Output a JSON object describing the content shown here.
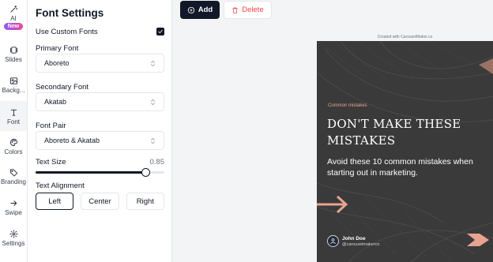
{
  "rail": {
    "items": [
      {
        "label": "AI",
        "badge": "New",
        "icon": "magic-wand-icon"
      },
      {
        "label": "Slides",
        "icon": "slides-icon"
      },
      {
        "label": "Backg...",
        "icon": "image-icon"
      },
      {
        "label": "Font",
        "icon": "font-icon"
      },
      {
        "label": "Colors",
        "icon": "palette-icon"
      },
      {
        "label": "Branding",
        "icon": "tag-icon"
      },
      {
        "label": "Swipe",
        "icon": "arrow-right-icon"
      },
      {
        "label": "Settings",
        "icon": "gear-icon"
      }
    ],
    "active": "Font"
  },
  "panel": {
    "title": "Font Settings",
    "use_custom_fonts": {
      "label": "Use Custom Fonts",
      "checked": true
    },
    "primary_font": {
      "label": "Primary Font",
      "value": "Aboreto"
    },
    "secondary_font": {
      "label": "Secondary Font",
      "value": "Akatab"
    },
    "font_pair": {
      "label": "Font Pair",
      "value": "Aboreto & Akatab"
    },
    "text_size": {
      "label": "Text Size",
      "value": "0.85",
      "level": 0.85
    },
    "text_alignment": {
      "label": "Text Alignment",
      "options": [
        "Left",
        "Center",
        "Right"
      ],
      "selected": "Left"
    }
  },
  "toolbar": {
    "add_label": "Add",
    "delete_label": "Delete"
  },
  "slide": {
    "created_with": "Created with CarouselMaker.co",
    "eyebrow": "Common mistakes",
    "headline": "DON'T MAKE THESE MISTAKES",
    "subline": "Avoid these 10 common mistakes when starting out in marketing.",
    "author_name": "John Doe",
    "author_handle": "@carouselmakerco",
    "accent_color": "#e8a491",
    "background_color": "#3a3a3a"
  }
}
